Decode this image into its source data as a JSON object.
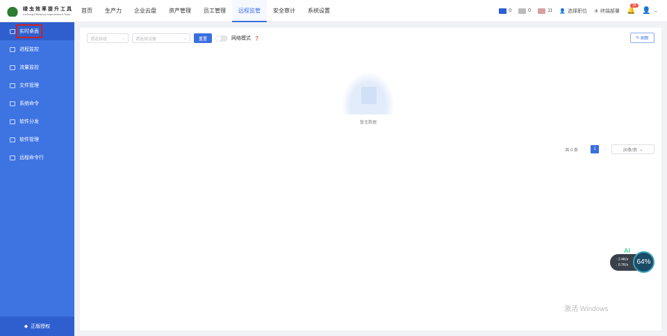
{
  "logo": {
    "title": "绿虫效率提升工具",
    "subtitle": "Lvchong Efficiency Improvement Tools"
  },
  "nav": [
    "首页",
    "生产力",
    "企业云盘",
    "资产管理",
    "员工管理",
    "远程监管",
    "安全审计",
    "系统设置"
  ],
  "status": {
    "online": "0",
    "idle": "0",
    "offline": "11",
    "select_post": "选择职位",
    "terminal_deploy": "终端部署",
    "notifications": "18"
  },
  "sidebar": {
    "items": [
      "实时桌面",
      "进程监控",
      "流量监控",
      "文件管理",
      "系统命令",
      "软件分发",
      "软件管理",
      "远程命令行"
    ],
    "footer": "正版授权"
  },
  "toolbar": {
    "group_placeholder": "请选择组",
    "device_placeholder": "请选择设备",
    "reset": "重置",
    "network_mode": "网络模式",
    "refresh": "刷新"
  },
  "empty": "暂无数据",
  "pager": {
    "total": "共 0 条",
    "page": "1",
    "size": "20条/页"
  },
  "ai": {
    "label": "AI",
    "up": "2.4K/s",
    "down": "0.7K/s",
    "percent": "64%"
  },
  "watermark": "激活 Windows",
  "colors": {
    "accent": "#3a6fe0",
    "sidebar": "#3e73e2"
  }
}
